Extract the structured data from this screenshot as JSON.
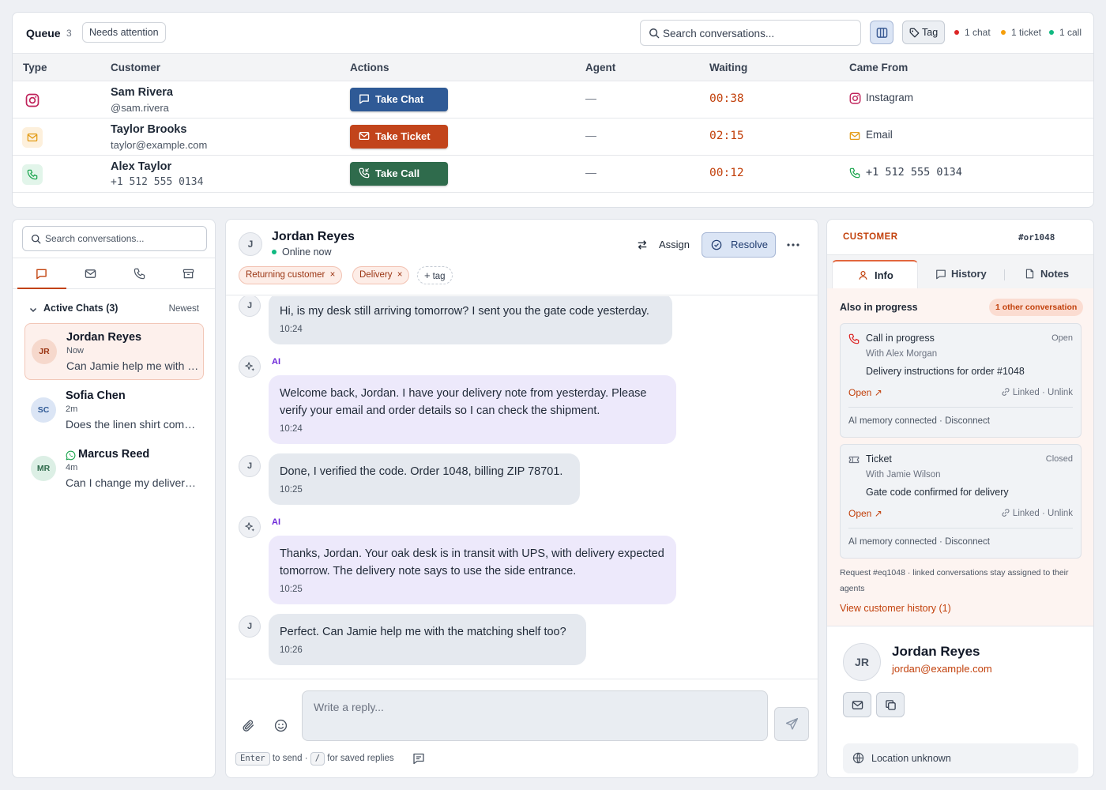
{
  "queue": {
    "title": "Queue",
    "count": "3",
    "needs_attention": "Needs attention",
    "search_placeholder": "Search conversations...",
    "tag_label": "Tag",
    "legend": [
      {
        "label": "1 chat",
        "color": "#dc2626"
      },
      {
        "label": "1 ticket",
        "color": "#f59e0b"
      },
      {
        "label": "1 call",
        "color": "#10b981"
      }
    ],
    "columns": {
      "type": "Type",
      "customer": "Customer",
      "actions": "Actions",
      "agent": "Agent",
      "waiting": "Waiting",
      "came_from": "Came From"
    },
    "rows": [
      {
        "type_icon": "instagram-icon",
        "name": "Sam Rivera",
        "sub": "@sam.rivera",
        "action": "Take Chat",
        "action_color": "#2f5a96",
        "agent": "—",
        "waiting": "00:38",
        "from": "Instagram"
      },
      {
        "type_icon": "mail-icon",
        "name": "Taylor Brooks",
        "sub": "taylor@example.com",
        "action": "Take Ticket",
        "action_color": "#c2441b",
        "agent": "—",
        "waiting": "02:15",
        "from": "Email"
      },
      {
        "type_icon": "phone-icon",
        "name": "Alex Taylor",
        "sub": "+1 512 555 0134",
        "action": "Take Call",
        "action_color": "#2f6b4c",
        "agent": "—",
        "waiting": "00:12",
        "from": "+1 512 555 0134"
      }
    ]
  },
  "left": {
    "search_placeholder": "Search conversations...",
    "tabs": [
      "chat-icon",
      "mail-icon",
      "phone-icon",
      "archive-icon"
    ],
    "active_chats": "Active Chats (3)",
    "sort": "Newest",
    "chats": [
      {
        "initials": "JR",
        "name": "Jordan Reyes",
        "time": "Now",
        "preview": "Can Jamie help me with the matching shelf too?"
      },
      {
        "initials": "SC",
        "name": "Sofia Chen",
        "time": "2m",
        "preview": "Does the linen shirt come in blue?"
      },
      {
        "initials": "MR",
        "name": "Marcus Reed",
        "time": "4m",
        "preview": "Can I change my delivery address?"
      }
    ]
  },
  "conversation": {
    "initial": "J",
    "name": "Jordan Reyes",
    "status": "Online now",
    "assign": "Assign",
    "resolve": "Resolve",
    "tags": [
      "Returning customer",
      "Delivery"
    ],
    "add_tag": "tag",
    "ai_label": "AI",
    "messages": [
      {
        "from": "J",
        "text": "Hi, is my desk still arriving tomorrow? I sent you the gate code yesterday.",
        "time": "10:24"
      },
      {
        "from": "AI",
        "text": "Welcome back, Jordan. I have your delivery note from yesterday. Please verify your email and order details so I can check the shipment.",
        "time": "10:24"
      },
      {
        "from": "J",
        "text": "Done, I verified the code. Order 1048, billing ZIP 78701.",
        "time": "10:25"
      },
      {
        "from": "AI",
        "text": "Thanks, Jordan. Your oak desk is in transit with UPS, with delivery expected tomorrow. The delivery note says to use the side entrance.",
        "time": "10:25"
      },
      {
        "from": "J",
        "text": "Perfect. Can Jamie help me with the matching shelf too?",
        "time": "10:26"
      }
    ],
    "reply_placeholder": "Write a reply...",
    "hint_enter": "Enter",
    "hint_to_send": "to send ·",
    "hint_slash": "/",
    "hint_saved": "for saved replies"
  },
  "customer_panel": {
    "label": "CUSTOMER",
    "id": "#or1048",
    "tabs": [
      "Info",
      "History",
      "Notes"
    ],
    "also_in_progress": "Also in progress",
    "other_badge": "1 other conversation",
    "cards": [
      {
        "icon": "phone-icon",
        "title": "Call in progress",
        "state": "Open",
        "with": "With Alex Morgan",
        "desc": "Delivery instructions for order #1048",
        "open": "Open ↗",
        "linked": "Linked · Unlink",
        "memory": "AI memory connected · Disconnect"
      },
      {
        "icon": "ticket-icon",
        "title": "Ticket",
        "state": "Closed",
        "with": "With Jamie Wilson",
        "desc": "Gate code confirmed for delivery",
        "open": "Open ↗",
        "linked": "Linked · Unlink",
        "memory": "AI memory connected · Disconnect"
      }
    ],
    "request_note": "Request #eq1048 · linked conversations stay assigned to their agents",
    "view_history": "View customer history (1)",
    "initials": "JR",
    "name": "Jordan Reyes",
    "email": "jordan@example.com",
    "location": "Location unknown"
  }
}
